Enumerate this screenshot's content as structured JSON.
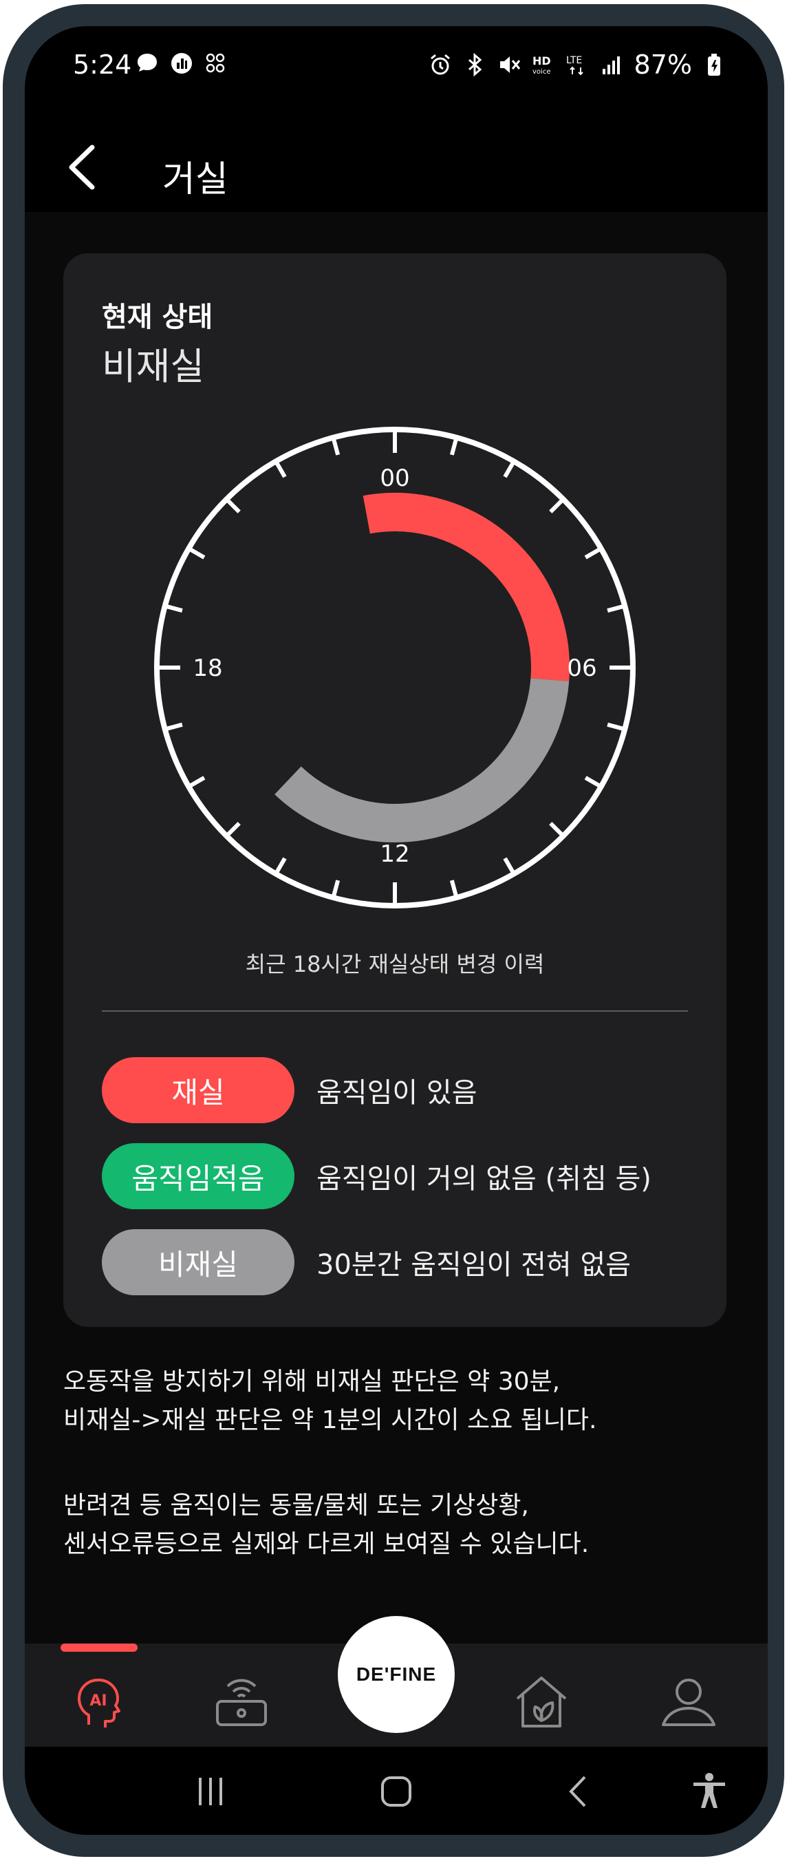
{
  "status_bar": {
    "time": "5:24",
    "battery": "87%",
    "icons": [
      "messenger-icon",
      "chart-icon",
      "grid-icon",
      "alarm-icon",
      "bluetooth-icon",
      "mute-icon",
      "hd-voice-icon",
      "lte-icon",
      "signal-icon",
      "battery-icon"
    ]
  },
  "header": {
    "title": "거실"
  },
  "status_card": {
    "label": "현재 상태",
    "value": "비재실",
    "clock": {
      "hour_labels": [
        "00",
        "06",
        "12",
        "18"
      ],
      "caption": "최근 18시간 재실상태 변경 이력",
      "segments": [
        {
          "state": "재실",
          "color": "#ff4d4d",
          "start_hour": 23.3,
          "end_hour": 6.3
        },
        {
          "state": "비재실",
          "color": "#9b9b9d",
          "start_hour": 6.3,
          "end_hour": 14.9
        }
      ]
    }
  },
  "legend": [
    {
      "label": "재실",
      "desc": "움직임이 있음",
      "color": "#ff4d4d"
    },
    {
      "label": "움직임적음",
      "desc": "움직임이 거의 없음 (취침 등)",
      "color": "#14b86e"
    },
    {
      "label": "비재실",
      "desc": "30분간 움직임이 전혀 없음",
      "color": "#9b9b9d"
    }
  ],
  "notes": {
    "line1": "오동작을 방지하기 위해 비재실 판단은 약 30분,",
    "line2": "비재실->재실 판단은 약 1분의 시간이 소요 됩니다.",
    "line3": "반려견 등 움직이는 동물/물체 또는 기상상황,",
    "line4": "센서오류등으로 실제와 다르게 보여질 수 있습니다."
  },
  "bottom_nav": {
    "center_label": "DE'FINE",
    "ai_label": "AI",
    "items": [
      "ai-head-icon",
      "router-icon",
      "define-button",
      "home-leaf-icon",
      "profile-icon"
    ]
  },
  "colors": {
    "accent": "#ff4d4d",
    "low_motion": "#14b86e",
    "absent": "#9b9b9d"
  }
}
